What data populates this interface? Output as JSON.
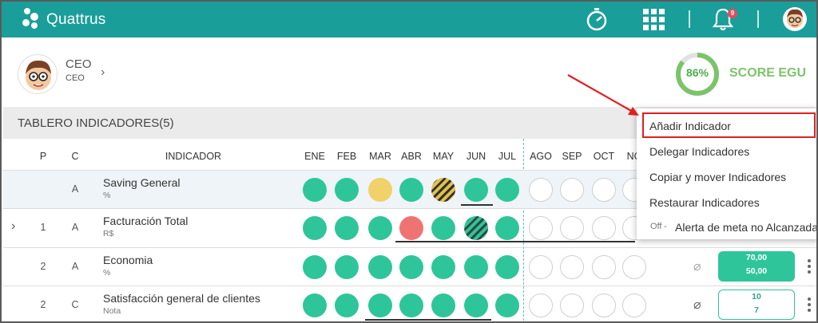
{
  "app": {
    "name": "Quattrus",
    "notification_count": "9"
  },
  "profile": {
    "name": "CEO",
    "role": "CEO"
  },
  "score": {
    "percent": "86%",
    "value": 0.86,
    "label": "SCORE EGU"
  },
  "board": {
    "title": "TABLERO INDICADORES(5)"
  },
  "columns": {
    "p": "P",
    "c": "C",
    "indicator": "INDICADOR",
    "months": [
      "ENE",
      "FEB",
      "MAR",
      "ABR",
      "MAY",
      "JUN",
      "JUL",
      "AGO",
      "SEP",
      "OCT",
      "NO"
    ]
  },
  "rows": [
    {
      "p": "",
      "c": "A",
      "name": "Saving General",
      "unit": "%",
      "statuses": [
        "green",
        "green",
        "yellow",
        "green",
        "hatched-yellow",
        "green",
        "green",
        "empty",
        "empty",
        "empty",
        "empty"
      ]
    },
    {
      "p": "1",
      "c": "A",
      "name": "Facturación Total",
      "unit": "R$",
      "statuses": [
        "green",
        "green",
        "green",
        "red",
        "green",
        "hatched-green",
        "green",
        "empty",
        "empty",
        "empty",
        "empty"
      ]
    },
    {
      "p": "2",
      "c": "A",
      "name": "Economia",
      "unit": "%",
      "statuses": [
        "green",
        "green",
        "green",
        "green",
        "green",
        "green",
        "green",
        "empty",
        "empty",
        "empty",
        "empty"
      ],
      "target": "70,00",
      "actual": "50,00"
    },
    {
      "p": "2",
      "c": "C",
      "name": "Satisfacción general de clientes",
      "unit": "Nota",
      "statuses": [
        "green",
        "green",
        "green",
        "green",
        "green",
        "green",
        "green",
        "empty",
        "empty",
        "empty",
        "empty"
      ],
      "target": "10",
      "actual": "7"
    }
  ],
  "menu": {
    "items": [
      "Añadir Indicador",
      "Delegar Indicadores",
      "Copiar y mover Indicadores",
      "Restaurar Indicadores"
    ],
    "toggle_state": "Off",
    "toggle_label": "Alerta de meta no Alcanzada"
  },
  "colors": {
    "brand": "#1a9e9a",
    "green": "#2fc59a",
    "yellow": "#f0d16a",
    "red": "#f07373",
    "highlight": "#e02020"
  }
}
